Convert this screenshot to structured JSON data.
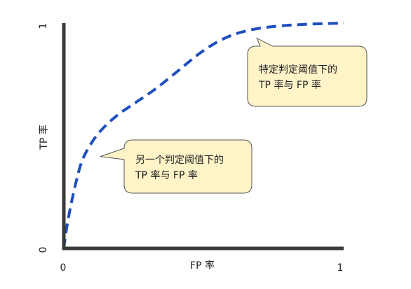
{
  "chart_data": {
    "type": "line",
    "title": "",
    "xlabel": "FP 率",
    "ylabel": "TP 率",
    "xlim": [
      0,
      1
    ],
    "ylim": [
      0,
      1
    ],
    "x_ticks": [
      "0",
      "1"
    ],
    "y_ticks": [
      "0",
      "1"
    ],
    "grid": false,
    "series": [
      {
        "style": "dashed",
        "color": "#1f4fbf",
        "points": [
          [
            0.0,
            0.0
          ],
          [
            0.01,
            0.09
          ],
          [
            0.03,
            0.22
          ],
          [
            0.06,
            0.37
          ],
          [
            0.09,
            0.45
          ],
          [
            0.13,
            0.52
          ],
          [
            0.19,
            0.59
          ],
          [
            0.26,
            0.65
          ],
          [
            0.33,
            0.71
          ],
          [
            0.41,
            0.79
          ],
          [
            0.49,
            0.87
          ],
          [
            0.57,
            0.93
          ],
          [
            0.65,
            0.965
          ],
          [
            0.75,
            0.985
          ],
          [
            0.87,
            0.995
          ],
          [
            1.0,
            1.0
          ]
        ]
      }
    ],
    "annotations": [
      {
        "lines": [
          "特定判定阈值下的",
          "TP 率与 FP 率"
        ],
        "point": [
          0.69,
          0.97
        ]
      },
      {
        "lines": [
          "另一个判定阈值下的",
          "TP 率与 FP 率"
        ],
        "point": [
          0.13,
          0.47
        ]
      }
    ]
  },
  "colors": {
    "axis": "#3a3a3a",
    "curve": "#1f4fbf",
    "callout_fill": "#fff3c8",
    "callout_stroke": "#555555"
  }
}
